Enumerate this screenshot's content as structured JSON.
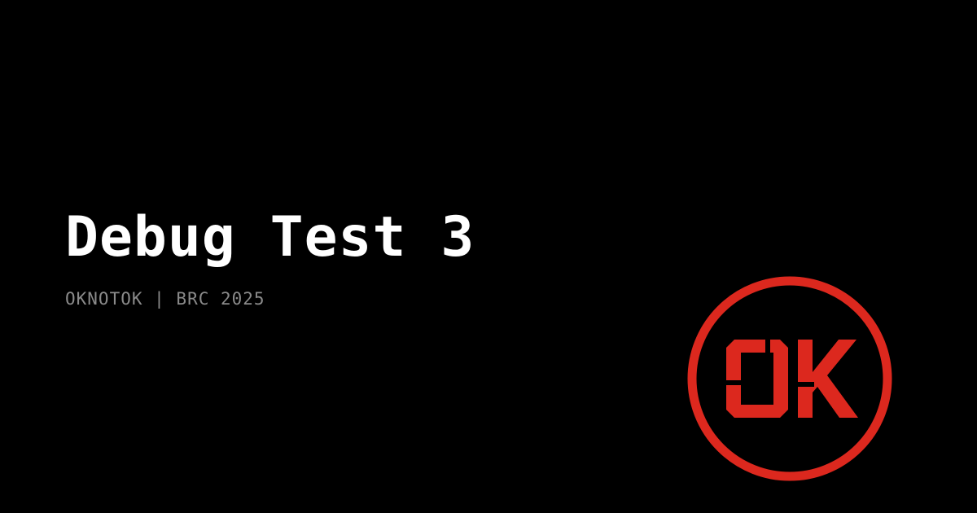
{
  "title": "Debug Test 3",
  "subtitle": "OKNOTOK | BRC 2025",
  "logo": {
    "text": "OK",
    "color": "#dc281e"
  },
  "colors": {
    "background": "#000000",
    "title": "#ffffff",
    "subtitle": "#8a8a8a"
  }
}
